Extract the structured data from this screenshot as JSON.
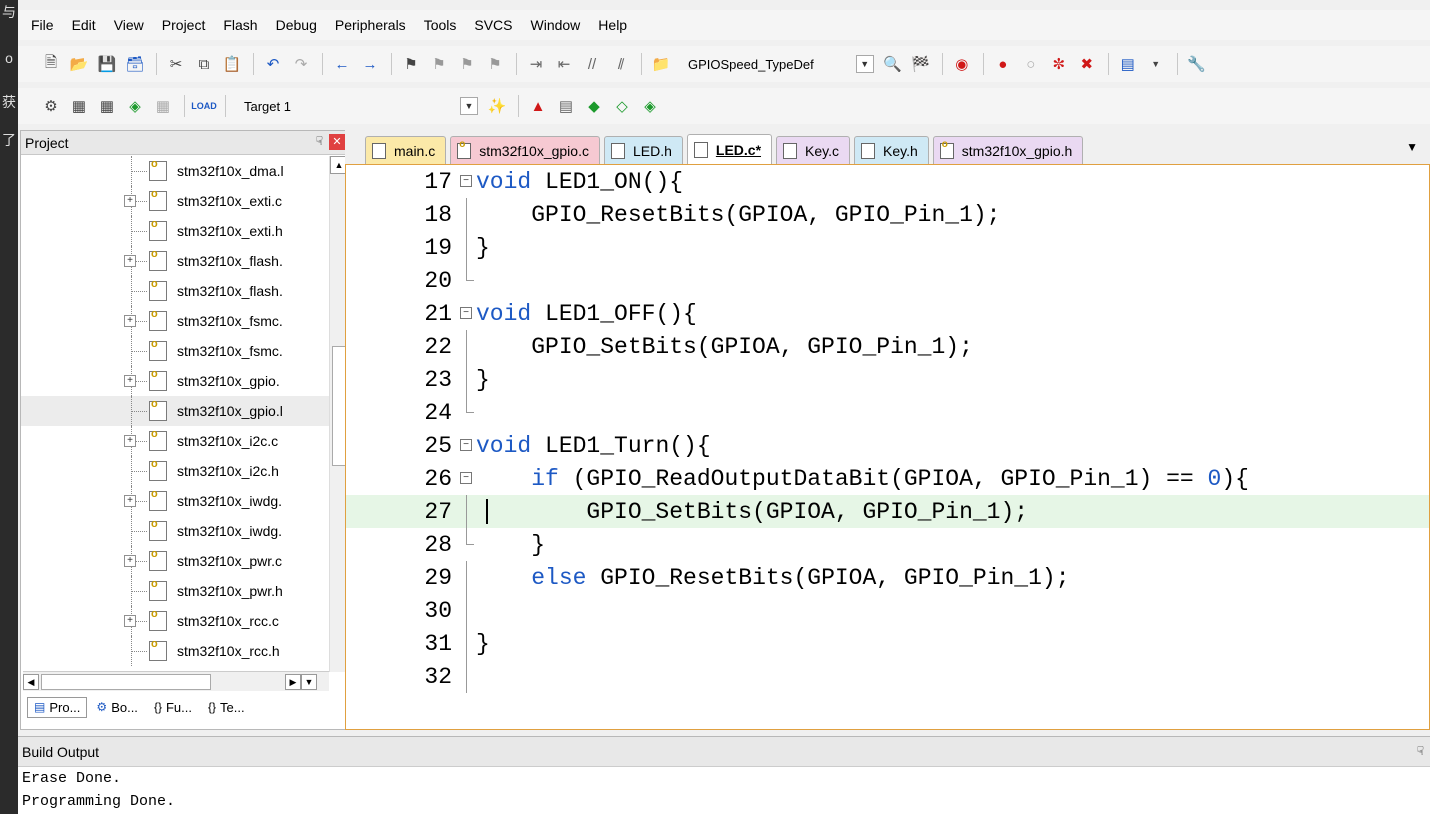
{
  "menu": [
    "File",
    "Edit",
    "View",
    "Project",
    "Flash",
    "Debug",
    "Peripherals",
    "Tools",
    "SVCS",
    "Window",
    "Help"
  ],
  "toolbar1": {
    "combo_text": "GPIOSpeed_TypeDef"
  },
  "toolbar2": {
    "target_label": "Target 1"
  },
  "project_panel": {
    "title": "Project",
    "tree_items": [
      {
        "label": "stm32f10x_dma.l",
        "expandable": false
      },
      {
        "label": "stm32f10x_exti.c",
        "expandable": true
      },
      {
        "label": "stm32f10x_exti.h",
        "expandable": false
      },
      {
        "label": "stm32f10x_flash.",
        "expandable": true
      },
      {
        "label": "stm32f10x_flash.",
        "expandable": false
      },
      {
        "label": "stm32f10x_fsmc.",
        "expandable": true
      },
      {
        "label": "stm32f10x_fsmc.",
        "expandable": false
      },
      {
        "label": "stm32f10x_gpio.",
        "expandable": true
      },
      {
        "label": "stm32f10x_gpio.l",
        "expandable": false,
        "selected": true
      },
      {
        "label": "stm32f10x_i2c.c",
        "expandable": true
      },
      {
        "label": "stm32f10x_i2c.h",
        "expandable": false
      },
      {
        "label": "stm32f10x_iwdg.",
        "expandable": true
      },
      {
        "label": "stm32f10x_iwdg.",
        "expandable": false
      },
      {
        "label": "stm32f10x_pwr.c",
        "expandable": true
      },
      {
        "label": "stm32f10x_pwr.h",
        "expandable": false
      },
      {
        "label": "stm32f10x_rcc.c",
        "expandable": true
      },
      {
        "label": "stm32f10x_rcc.h",
        "expandable": false
      }
    ],
    "bottom_tabs": [
      "Pro...",
      "Bo...",
      "Fu...",
      "Te..."
    ]
  },
  "editor": {
    "tabs": [
      {
        "label": "main.c",
        "color": "#fbe9a8",
        "key": false
      },
      {
        "label": "stm32f10x_gpio.c",
        "color": "#f6c9d2",
        "key": true
      },
      {
        "label": "LED.h",
        "color": "#cfe9f5",
        "key": false
      },
      {
        "label": "LED.c*",
        "color": "#fbe9a8",
        "key": false,
        "active": true
      },
      {
        "label": "Key.c",
        "color": "#ead9f2",
        "key": false
      },
      {
        "label": "Key.h",
        "color": "#cfe9f5",
        "key": false
      },
      {
        "label": "stm32f10x_gpio.h",
        "color": "#ead9f2",
        "key": true
      }
    ],
    "lines": [
      {
        "no": "17",
        "fold": "box",
        "parts": [
          [
            "kw",
            "void"
          ],
          [
            "t",
            " LED1_ON(){"
          ]
        ]
      },
      {
        "no": "18",
        "fold": "line",
        "parts": [
          [
            "t",
            "    GPIO_ResetBits(GPIOA, GPIO_Pin_1);"
          ]
        ]
      },
      {
        "no": "19",
        "fold": "line",
        "parts": [
          [
            "t",
            "}"
          ]
        ]
      },
      {
        "no": "20",
        "fold": "end",
        "parts": []
      },
      {
        "no": "21",
        "fold": "box",
        "parts": [
          [
            "kw",
            "void"
          ],
          [
            "t",
            " LED1_OFF(){"
          ]
        ]
      },
      {
        "no": "22",
        "fold": "line",
        "parts": [
          [
            "t",
            "    GPIO_SetBits(GPIOA, GPIO_Pin_1);"
          ]
        ]
      },
      {
        "no": "23",
        "fold": "line",
        "parts": [
          [
            "t",
            "}"
          ]
        ]
      },
      {
        "no": "24",
        "fold": "end",
        "parts": []
      },
      {
        "no": "25",
        "fold": "box",
        "parts": [
          [
            "kw",
            "void"
          ],
          [
            "t",
            " LED1_Turn(){"
          ]
        ]
      },
      {
        "no": "26",
        "fold": "box",
        "parts": [
          [
            "t",
            "    "
          ],
          [
            "kw",
            "if"
          ],
          [
            "t",
            " (GPIO_ReadOutputDataBit(GPIOA, GPIO_Pin_1) == "
          ],
          [
            "num",
            "0"
          ],
          [
            "t",
            "){"
          ]
        ]
      },
      {
        "no": "27",
        "fold": "line",
        "highlight": true,
        "parts": [
          [
            "t",
            "        GPIO_SetBits(GPIOA, GPIO_Pin_1);"
          ]
        ]
      },
      {
        "no": "28",
        "fold": "end",
        "parts": [
          [
            "t",
            "    }"
          ]
        ]
      },
      {
        "no": "29",
        "fold": "line",
        "parts": [
          [
            "t",
            "    "
          ],
          [
            "kw",
            "else"
          ],
          [
            "t",
            " GPIO_ResetBits(GPIOA, GPIO_Pin_1);"
          ]
        ]
      },
      {
        "no": "30",
        "fold": "line",
        "parts": []
      },
      {
        "no": "31",
        "fold": "line",
        "parts": [
          [
            "t",
            "}"
          ]
        ]
      },
      {
        "no": "32",
        "fold": "line",
        "parts": []
      }
    ]
  },
  "build_output": {
    "title": "Build Output",
    "lines": [
      "Erase Done.",
      "Programming Done."
    ]
  },
  "left_strip_glyphs": [
    "与",
    "o",
    "获",
    "了"
  ]
}
